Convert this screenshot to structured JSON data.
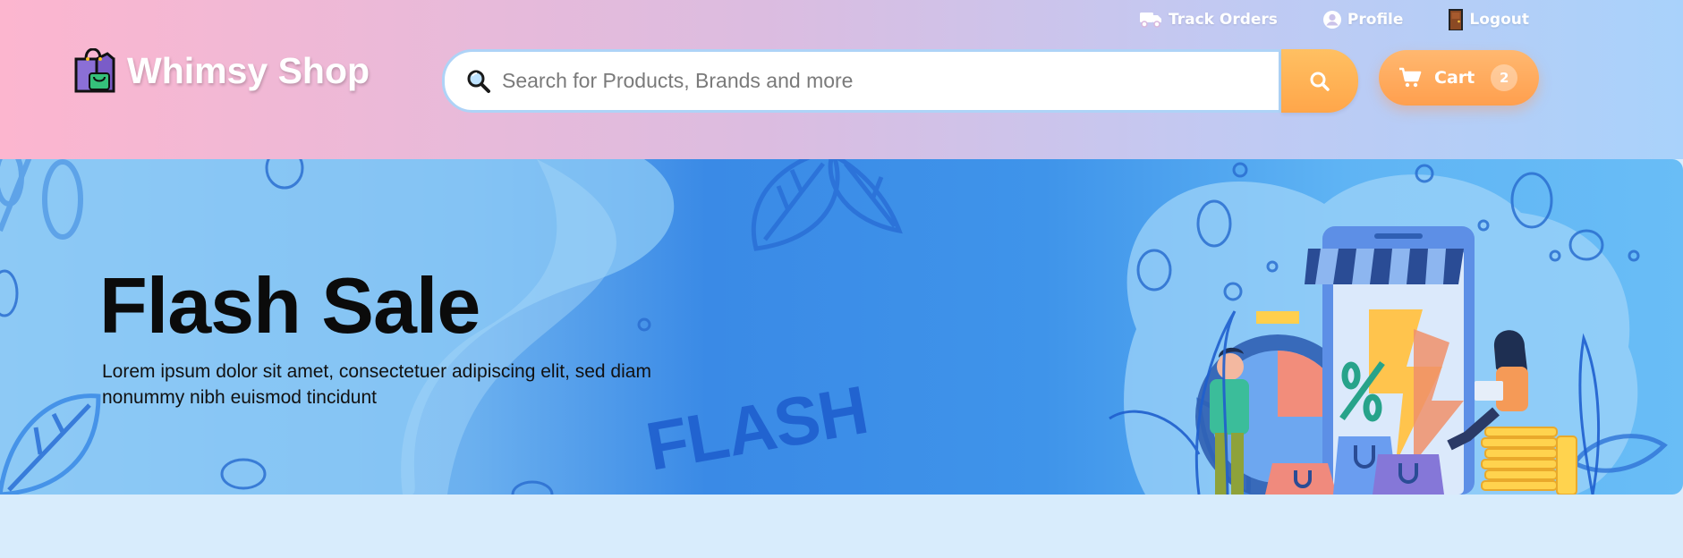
{
  "header": {
    "brand": "Whimsy Shop",
    "links": {
      "track_orders": "Track Orders",
      "profile": "Profile",
      "logout": "Logout"
    },
    "search": {
      "placeholder": "Search for Products, Brands and more",
      "value": ""
    },
    "cart": {
      "label": "Cart",
      "count": "2"
    }
  },
  "banner": {
    "title": "Flash Sale",
    "subtitle": "Lorem ipsum dolor sit amet, consectetuer adipiscing elit, sed diam nonummy nibh euismod tincidunt",
    "decor_word": "FLASH"
  },
  "icons": {
    "track": "truck-icon",
    "profile": "user-circle-icon",
    "logout": "door-icon",
    "brand": "shopping-bag-icon",
    "search_prefix": "magnifier-icon",
    "search_button": "search-icon",
    "cart": "cart-icon"
  },
  "colors": {
    "accent_orange": "#ffa64a",
    "header_pink": "#fcb6cf",
    "header_blue": "#a9d2fb",
    "banner_blue": "#3a8ae6",
    "page_background": "#d8ecfc"
  }
}
